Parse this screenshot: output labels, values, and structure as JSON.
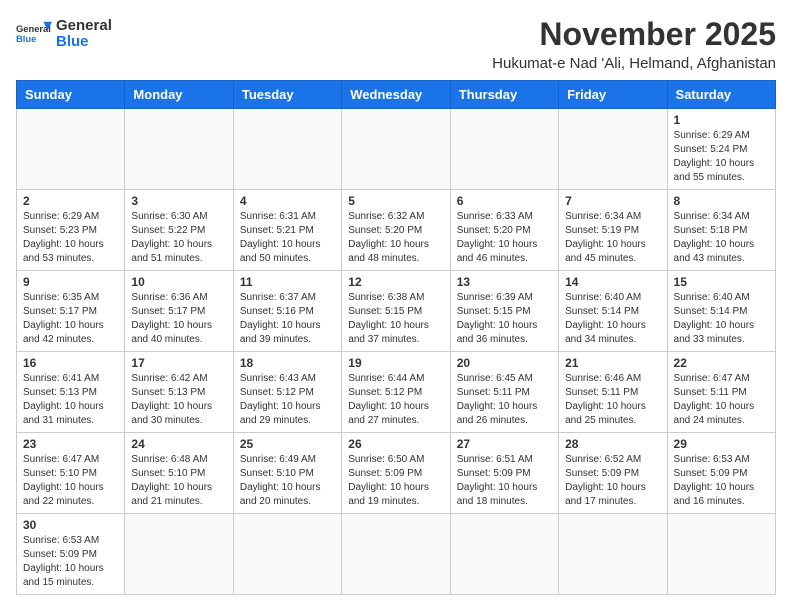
{
  "header": {
    "logo_general": "General",
    "logo_blue": "Blue",
    "title": "November 2025",
    "subtitle": "Hukumat-e Nad 'Ali, Helmand, Afghanistan"
  },
  "weekdays": [
    "Sunday",
    "Monday",
    "Tuesday",
    "Wednesday",
    "Thursday",
    "Friday",
    "Saturday"
  ],
  "weeks": [
    [
      {
        "day": "",
        "info": ""
      },
      {
        "day": "",
        "info": ""
      },
      {
        "day": "",
        "info": ""
      },
      {
        "day": "",
        "info": ""
      },
      {
        "day": "",
        "info": ""
      },
      {
        "day": "",
        "info": ""
      },
      {
        "day": "1",
        "info": "Sunrise: 6:29 AM\nSunset: 5:24 PM\nDaylight: 10 hours and 55 minutes."
      }
    ],
    [
      {
        "day": "2",
        "info": "Sunrise: 6:29 AM\nSunset: 5:23 PM\nDaylight: 10 hours and 53 minutes."
      },
      {
        "day": "3",
        "info": "Sunrise: 6:30 AM\nSunset: 5:22 PM\nDaylight: 10 hours and 51 minutes."
      },
      {
        "day": "4",
        "info": "Sunrise: 6:31 AM\nSunset: 5:21 PM\nDaylight: 10 hours and 50 minutes."
      },
      {
        "day": "5",
        "info": "Sunrise: 6:32 AM\nSunset: 5:20 PM\nDaylight: 10 hours and 48 minutes."
      },
      {
        "day": "6",
        "info": "Sunrise: 6:33 AM\nSunset: 5:20 PM\nDaylight: 10 hours and 46 minutes."
      },
      {
        "day": "7",
        "info": "Sunrise: 6:34 AM\nSunset: 5:19 PM\nDaylight: 10 hours and 45 minutes."
      },
      {
        "day": "8",
        "info": "Sunrise: 6:34 AM\nSunset: 5:18 PM\nDaylight: 10 hours and 43 minutes."
      }
    ],
    [
      {
        "day": "9",
        "info": "Sunrise: 6:35 AM\nSunset: 5:17 PM\nDaylight: 10 hours and 42 minutes."
      },
      {
        "day": "10",
        "info": "Sunrise: 6:36 AM\nSunset: 5:17 PM\nDaylight: 10 hours and 40 minutes."
      },
      {
        "day": "11",
        "info": "Sunrise: 6:37 AM\nSunset: 5:16 PM\nDaylight: 10 hours and 39 minutes."
      },
      {
        "day": "12",
        "info": "Sunrise: 6:38 AM\nSunset: 5:15 PM\nDaylight: 10 hours and 37 minutes."
      },
      {
        "day": "13",
        "info": "Sunrise: 6:39 AM\nSunset: 5:15 PM\nDaylight: 10 hours and 36 minutes."
      },
      {
        "day": "14",
        "info": "Sunrise: 6:40 AM\nSunset: 5:14 PM\nDaylight: 10 hours and 34 minutes."
      },
      {
        "day": "15",
        "info": "Sunrise: 6:40 AM\nSunset: 5:14 PM\nDaylight: 10 hours and 33 minutes."
      }
    ],
    [
      {
        "day": "16",
        "info": "Sunrise: 6:41 AM\nSunset: 5:13 PM\nDaylight: 10 hours and 31 minutes."
      },
      {
        "day": "17",
        "info": "Sunrise: 6:42 AM\nSunset: 5:13 PM\nDaylight: 10 hours and 30 minutes."
      },
      {
        "day": "18",
        "info": "Sunrise: 6:43 AM\nSunset: 5:12 PM\nDaylight: 10 hours and 29 minutes."
      },
      {
        "day": "19",
        "info": "Sunrise: 6:44 AM\nSunset: 5:12 PM\nDaylight: 10 hours and 27 minutes."
      },
      {
        "day": "20",
        "info": "Sunrise: 6:45 AM\nSunset: 5:11 PM\nDaylight: 10 hours and 26 minutes."
      },
      {
        "day": "21",
        "info": "Sunrise: 6:46 AM\nSunset: 5:11 PM\nDaylight: 10 hours and 25 minutes."
      },
      {
        "day": "22",
        "info": "Sunrise: 6:47 AM\nSunset: 5:11 PM\nDaylight: 10 hours and 24 minutes."
      }
    ],
    [
      {
        "day": "23",
        "info": "Sunrise: 6:47 AM\nSunset: 5:10 PM\nDaylight: 10 hours and 22 minutes."
      },
      {
        "day": "24",
        "info": "Sunrise: 6:48 AM\nSunset: 5:10 PM\nDaylight: 10 hours and 21 minutes."
      },
      {
        "day": "25",
        "info": "Sunrise: 6:49 AM\nSunset: 5:10 PM\nDaylight: 10 hours and 20 minutes."
      },
      {
        "day": "26",
        "info": "Sunrise: 6:50 AM\nSunset: 5:09 PM\nDaylight: 10 hours and 19 minutes."
      },
      {
        "day": "27",
        "info": "Sunrise: 6:51 AM\nSunset: 5:09 PM\nDaylight: 10 hours and 18 minutes."
      },
      {
        "day": "28",
        "info": "Sunrise: 6:52 AM\nSunset: 5:09 PM\nDaylight: 10 hours and 17 minutes."
      },
      {
        "day": "29",
        "info": "Sunrise: 6:53 AM\nSunset: 5:09 PM\nDaylight: 10 hours and 16 minutes."
      }
    ],
    [
      {
        "day": "30",
        "info": "Sunrise: 6:53 AM\nSunset: 5:09 PM\nDaylight: 10 hours and 15 minutes."
      },
      {
        "day": "",
        "info": ""
      },
      {
        "day": "",
        "info": ""
      },
      {
        "day": "",
        "info": ""
      },
      {
        "day": "",
        "info": ""
      },
      {
        "day": "",
        "info": ""
      },
      {
        "day": "",
        "info": ""
      }
    ]
  ]
}
